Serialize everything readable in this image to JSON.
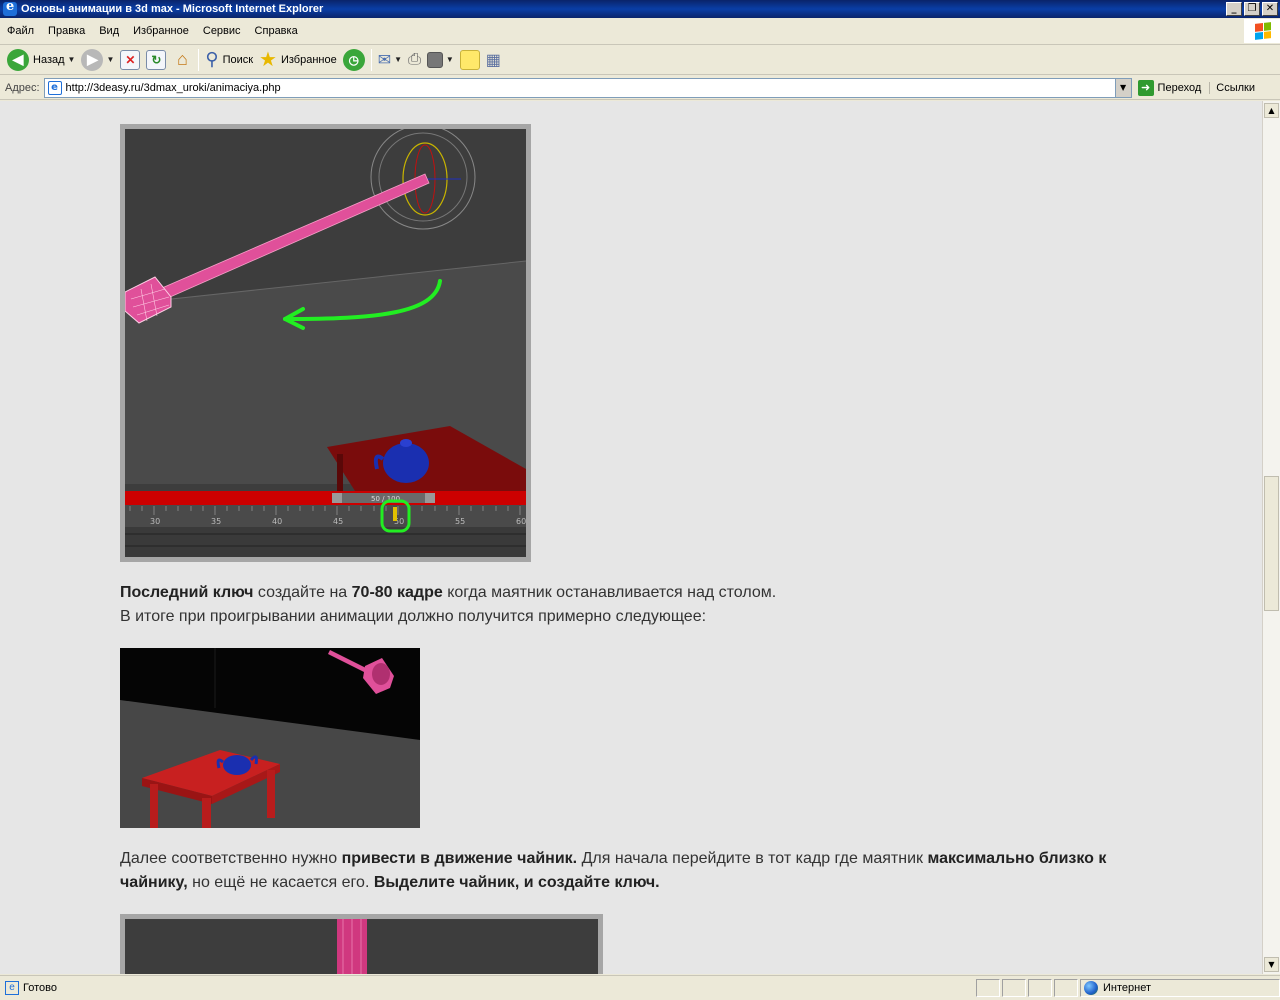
{
  "window": {
    "title": "Основы анимации в 3d max - Microsoft Internet Explorer",
    "buttons": {
      "minimize": "_",
      "restore": "❐",
      "close": "✕"
    }
  },
  "menu": [
    "Файл",
    "Правка",
    "Вид",
    "Избранное",
    "Сервис",
    "Справка"
  ],
  "toolbar": {
    "back_label": "Назад",
    "search_label": "Поиск",
    "favorites_label": "Избранное"
  },
  "address": {
    "label": "Адрес:",
    "url": "http://3deasy.ru/3dmax_uroki/animaciya.php",
    "go_label": "Переход",
    "links_label": "Ссылки"
  },
  "content": {
    "timeline": {
      "frame_counter": "50 / 100",
      "ticks": [
        "30",
        "35",
        "40",
        "45",
        "50",
        "55",
        "60"
      ]
    },
    "para1": {
      "b1": "Последний ключ",
      "t1": " создайте на ",
      "b2": "70-80 кадре",
      "t2": " когда маятник останавливается над столом."
    },
    "para1_line2": "В итоге при проигрывании анимации должно получится примерно следующее:",
    "para2": {
      "t1": "Далее соответственно нужно ",
      "b1": "привести в движение чайник.",
      "t2": " Для начала перейдите в тот кадр где маятник ",
      "b2": "максимально близко к чайнику,",
      "t3": " но ещё не касается его. ",
      "b3": "Выделите чайник, и создайте ключ."
    }
  },
  "status": {
    "text": "Готово",
    "zone": "Интернет"
  },
  "colors": {
    "titlebar": "#0a246a",
    "highlight_green": "#22ee22",
    "timeline_red": "#cc0000",
    "table_red": "#7a0c0c",
    "teapot_blue": "#1a2fb0",
    "pendulum_pink": "#e0509a"
  }
}
